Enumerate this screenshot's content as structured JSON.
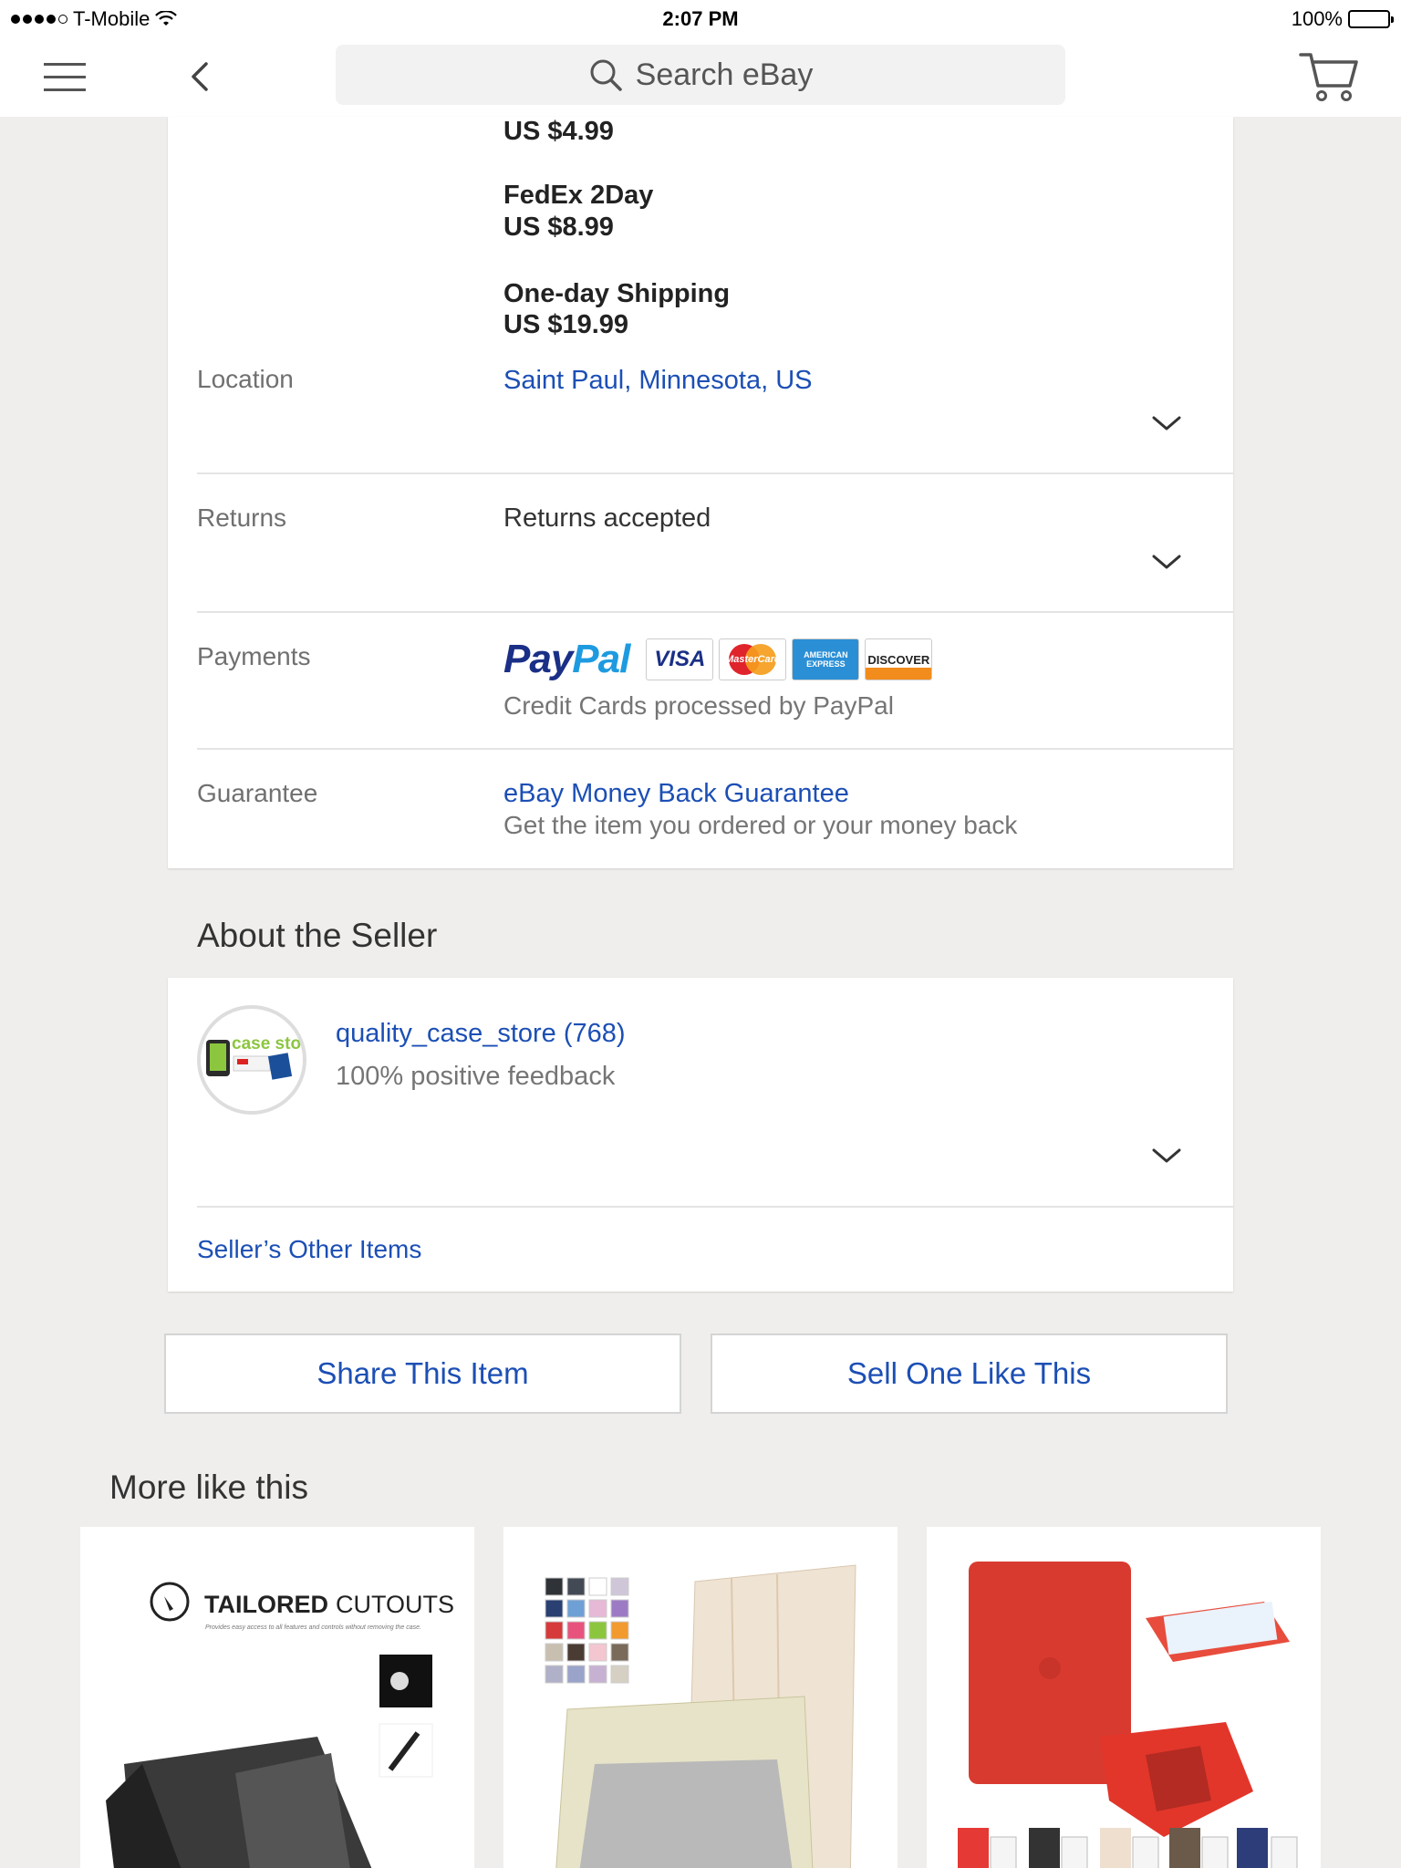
{
  "status_bar": {
    "carrier": "T-Mobile",
    "time": "2:07 PM",
    "battery": "100%"
  },
  "search": {
    "placeholder": "Search eBay"
  },
  "shipping": {
    "option0_price": "US $4.99",
    "option1_name": "FedEx 2Day",
    "option1_price": "US $8.99",
    "option2_name": "One-day Shipping",
    "option2_price": "US $19.99"
  },
  "location": {
    "label": "Location",
    "value": "Saint Paul, Minnesota, US"
  },
  "returns": {
    "label": "Returns",
    "value": "Returns accepted"
  },
  "payments": {
    "label": "Payments",
    "paypal_pay": "Pay",
    "paypal_pal": "Pal",
    "visa": "VISA",
    "mastercard": "MasterCard",
    "amex": "AMERICAN EXPRESS",
    "discover": "DISCOVER",
    "note": "Credit Cards processed by PayPal"
  },
  "guarantee": {
    "label": "Guarantee",
    "link": "eBay Money Back Guarantee",
    "note": "Get the item you ordered or your money back"
  },
  "about_seller": {
    "title": "About the Seller",
    "seller_name": "quality_case_store (768)",
    "feedback": "100% positive feedback",
    "other_items": "Seller’s Other Items",
    "avatar_text": "case stor"
  },
  "actions": {
    "share": "Share This Item",
    "sell": "Sell One Like This"
  },
  "more_like_this": {
    "title": "More like this",
    "tile1_heading_bold": "TAILORED",
    "tile1_heading_light": "CUTOUTS",
    "tile1_caption": "Provides easy access to all features and controls without removing the case."
  },
  "colors": {
    "link": "#1c4fb5",
    "background": "#efeeec"
  }
}
